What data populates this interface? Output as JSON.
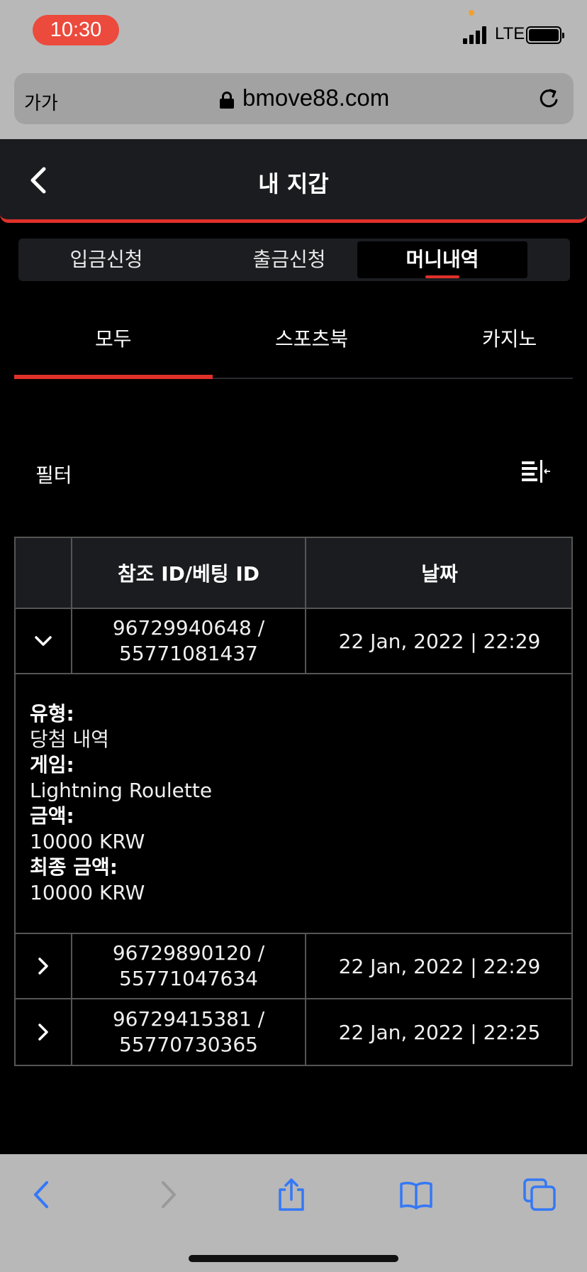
{
  "status_bar": {
    "time": "10:30",
    "network": "LTE"
  },
  "browser": {
    "text_size_label": "가가",
    "domain": "bmove88.com"
  },
  "header": {
    "title": "내 지갑"
  },
  "segments": [
    {
      "label": "입금신청",
      "active": false
    },
    {
      "label": "출금신청",
      "active": false
    },
    {
      "label": "머니내역",
      "active": true
    }
  ],
  "subtabs": [
    {
      "label": "모두",
      "active": true
    },
    {
      "label": "스포츠북",
      "active": false
    },
    {
      "label": "카지노",
      "active": false
    }
  ],
  "filter": {
    "label": "필터"
  },
  "table": {
    "headers": {
      "expand": "",
      "ref_id": "참조 ID/베팅 ID",
      "date": "날짜"
    },
    "rows": [
      {
        "ref_line1": "96729940648 /",
        "ref_line2": "55771081437",
        "date": "22 Jan, 2022 | 22:29",
        "expanded": true
      },
      {
        "ref_line1": "96729890120 /",
        "ref_line2": "55771047634",
        "date": "22 Jan, 2022 | 22:29",
        "expanded": false
      },
      {
        "ref_line1": "96729415381 /",
        "ref_line2": "55770730365",
        "date": "22 Jan, 2022 | 22:25",
        "expanded": false
      }
    ],
    "detail": {
      "type_label": "유형:",
      "type_value": "당첨 내역",
      "game_label": "게임:",
      "game_value": "Lightning Roulette",
      "amount_label": "금액:",
      "amount_value": "10000 KRW",
      "final_label": "최종 금액:",
      "final_value": "10000 KRW"
    }
  },
  "colors": {
    "accent": "#e0302b",
    "header_bg": "#1b1c20",
    "ios_blue": "#3478f6"
  }
}
